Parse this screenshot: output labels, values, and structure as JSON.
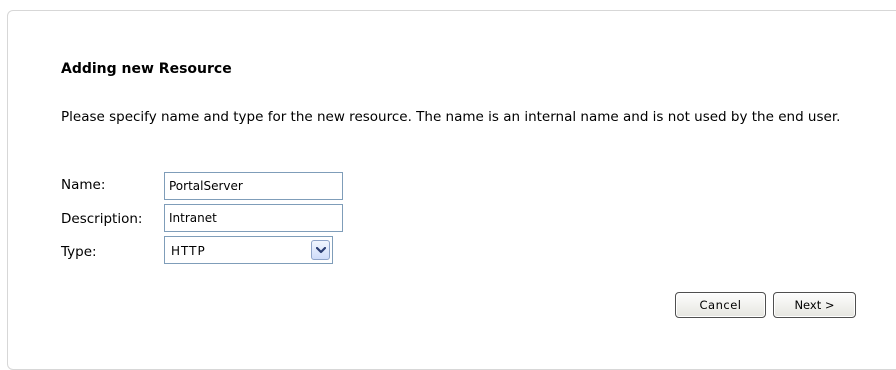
{
  "dialog": {
    "title": "Adding new Resource",
    "description": "Please specify name and type for the new resource. The name is an internal name and is not used by the end user."
  },
  "form": {
    "name_label": "Name:",
    "name_value": "PortalServer",
    "description_label": "Description:",
    "description_value": "Intranet",
    "type_label": "Type:",
    "type_value": "HTTP"
  },
  "icons": {
    "type_dropdown": "chevron-down-icon"
  },
  "buttons": {
    "cancel_label": "Cancel",
    "next_label": "Next >"
  },
  "colors": {
    "field_border": "#7f9db9",
    "panel_border": "#d7d7d7"
  }
}
